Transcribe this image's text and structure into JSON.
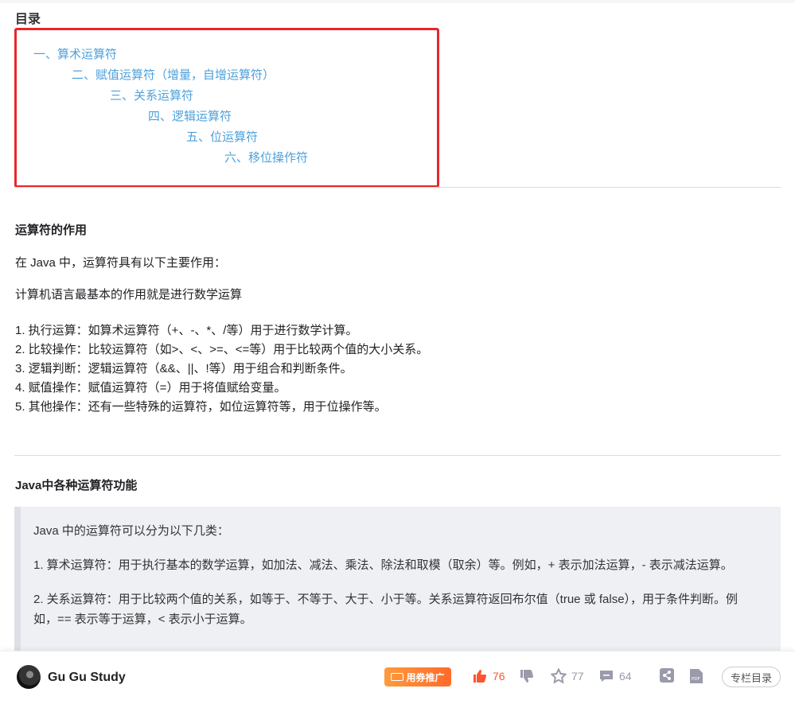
{
  "toc": {
    "title": "目录",
    "items": [
      "一、算术运算符",
      "二、赋值运算符（增量，自增运算符）",
      "三、关系运算符",
      "四、逻辑运算符",
      "五、位运算符",
      "六、移位操作符"
    ]
  },
  "section1": {
    "heading": "运算符的作用",
    "p1": "在 Java 中，运算符具有以下主要作用：",
    "p2": "计算机语言最基本的作用就是进行数学运算",
    "list": [
      "1. 执行运算：如算术运算符（+、-、*、/等）用于进行数学计算。",
      "2. 比较操作：比较运算符（如>、<、>=、<=等）用于比较两个值的大小关系。",
      "3. 逻辑判断：逻辑运算符（&&、||、!等）用于组合和判断条件。",
      "4. 赋值操作：赋值运算符（=）用于将值赋给变量。",
      "5. 其他操作：还有一些特殊的运算符，如位运算符等，用于位操作等。"
    ]
  },
  "section2": {
    "heading": "Java中各种运算符功能",
    "quote": [
      "Java 中的运算符可以分为以下几类：",
      "1. 算术运算符：用于执行基本的数学运算，如加法、减法、乘法、除法和取模（取余）等。例如，+ 表示加法运算，- 表示减法运算。",
      "2. 关系运算符：用于比较两个值的关系，如等于、不等于、大于、小于等。关系运算符返回布尔值（true 或 false），用于条件判断。例如，== 表示等于运算，< 表示小于运算。"
    ]
  },
  "footer": {
    "author": "Gu Gu Study",
    "promo_label": "用券推广",
    "likes": "76",
    "favorites": "77",
    "comments": "64",
    "toc_button": "专栏目录",
    "accent": "#fc5531"
  }
}
